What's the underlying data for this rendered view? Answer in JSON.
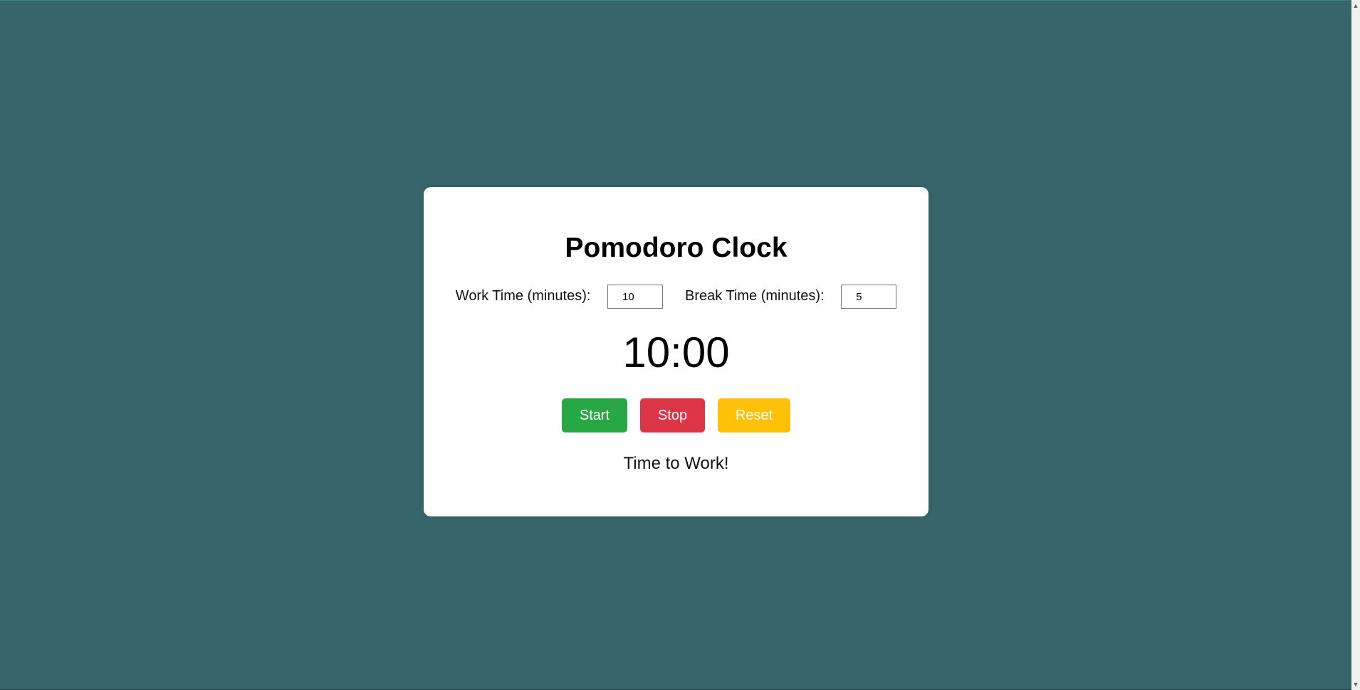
{
  "title": "Pomodoro Clock",
  "settings": {
    "work_label": "Work Time (minutes):",
    "work_value": "10",
    "break_label": "Break Time (minutes):",
    "break_value": "5"
  },
  "timer": {
    "display": "10:00"
  },
  "controls": {
    "start_label": "Start",
    "stop_label": "Stop",
    "reset_label": "Reset"
  },
  "status": "Time to Work!",
  "colors": {
    "background": "#36666c",
    "start": "#28a745",
    "stop": "#dc3545",
    "reset": "#ffc107"
  },
  "scrollbar": {
    "up_icon": "chevron-up-icon",
    "down_icon": "chevron-down-icon"
  }
}
